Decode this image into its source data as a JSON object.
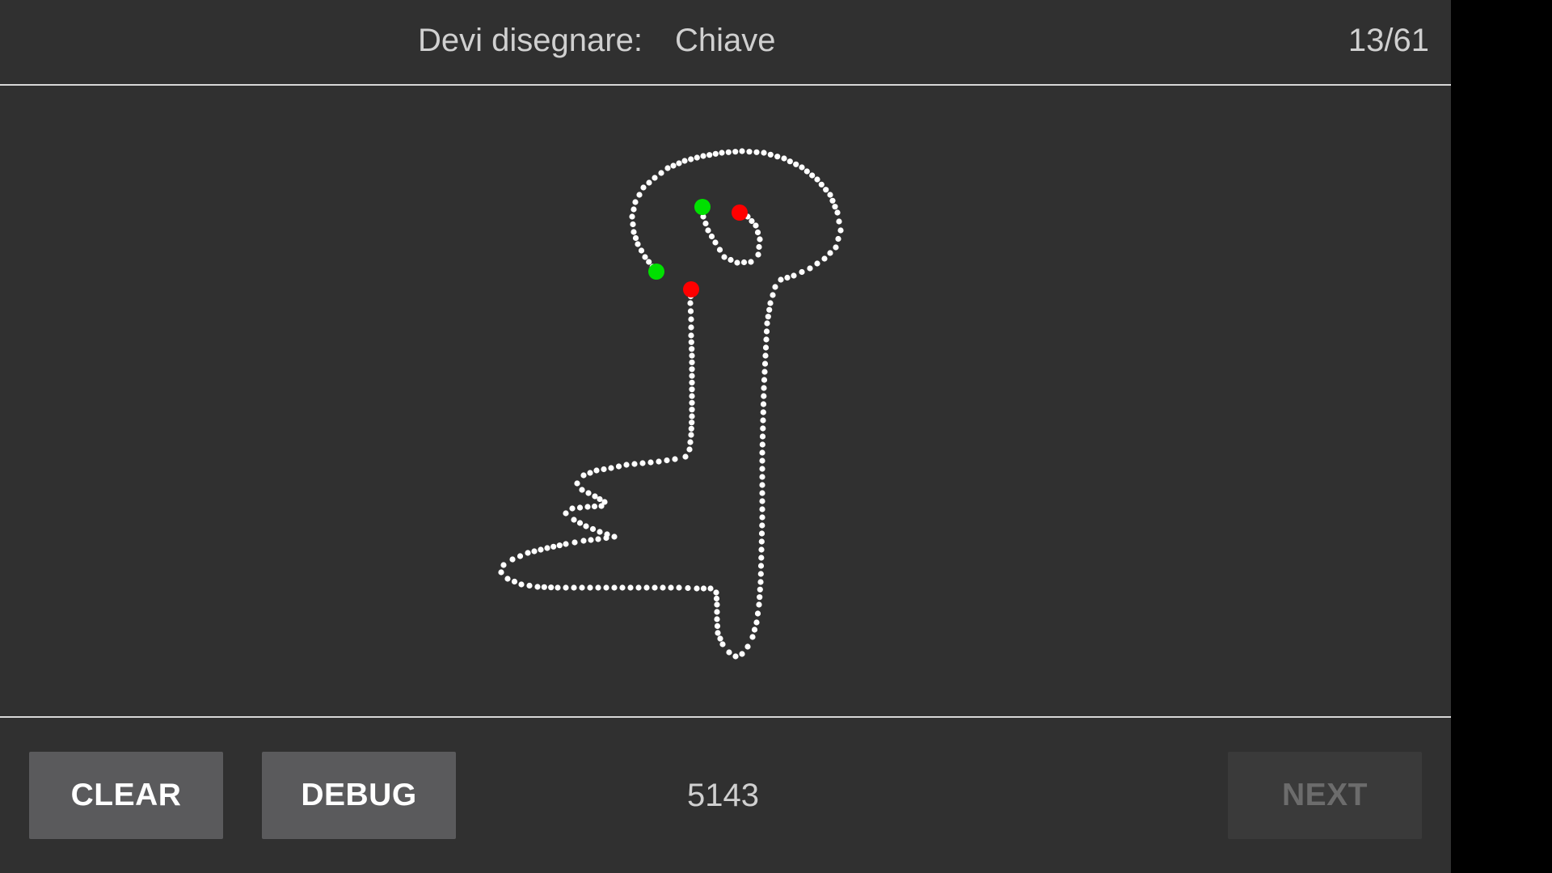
{
  "header": {
    "prompt_label": "Devi disegnare:",
    "prompt_word": "Chiave",
    "progress": "13/61"
  },
  "toolbar": {
    "clear_label": "CLEAR",
    "debug_label": "DEBUG",
    "score": "5143",
    "next_label": "NEXT"
  },
  "colors": {
    "background": "#303030",
    "stroke_dot": "#ffffff",
    "stroke_start": "#00e000",
    "stroke_end": "#ff0000"
  }
}
